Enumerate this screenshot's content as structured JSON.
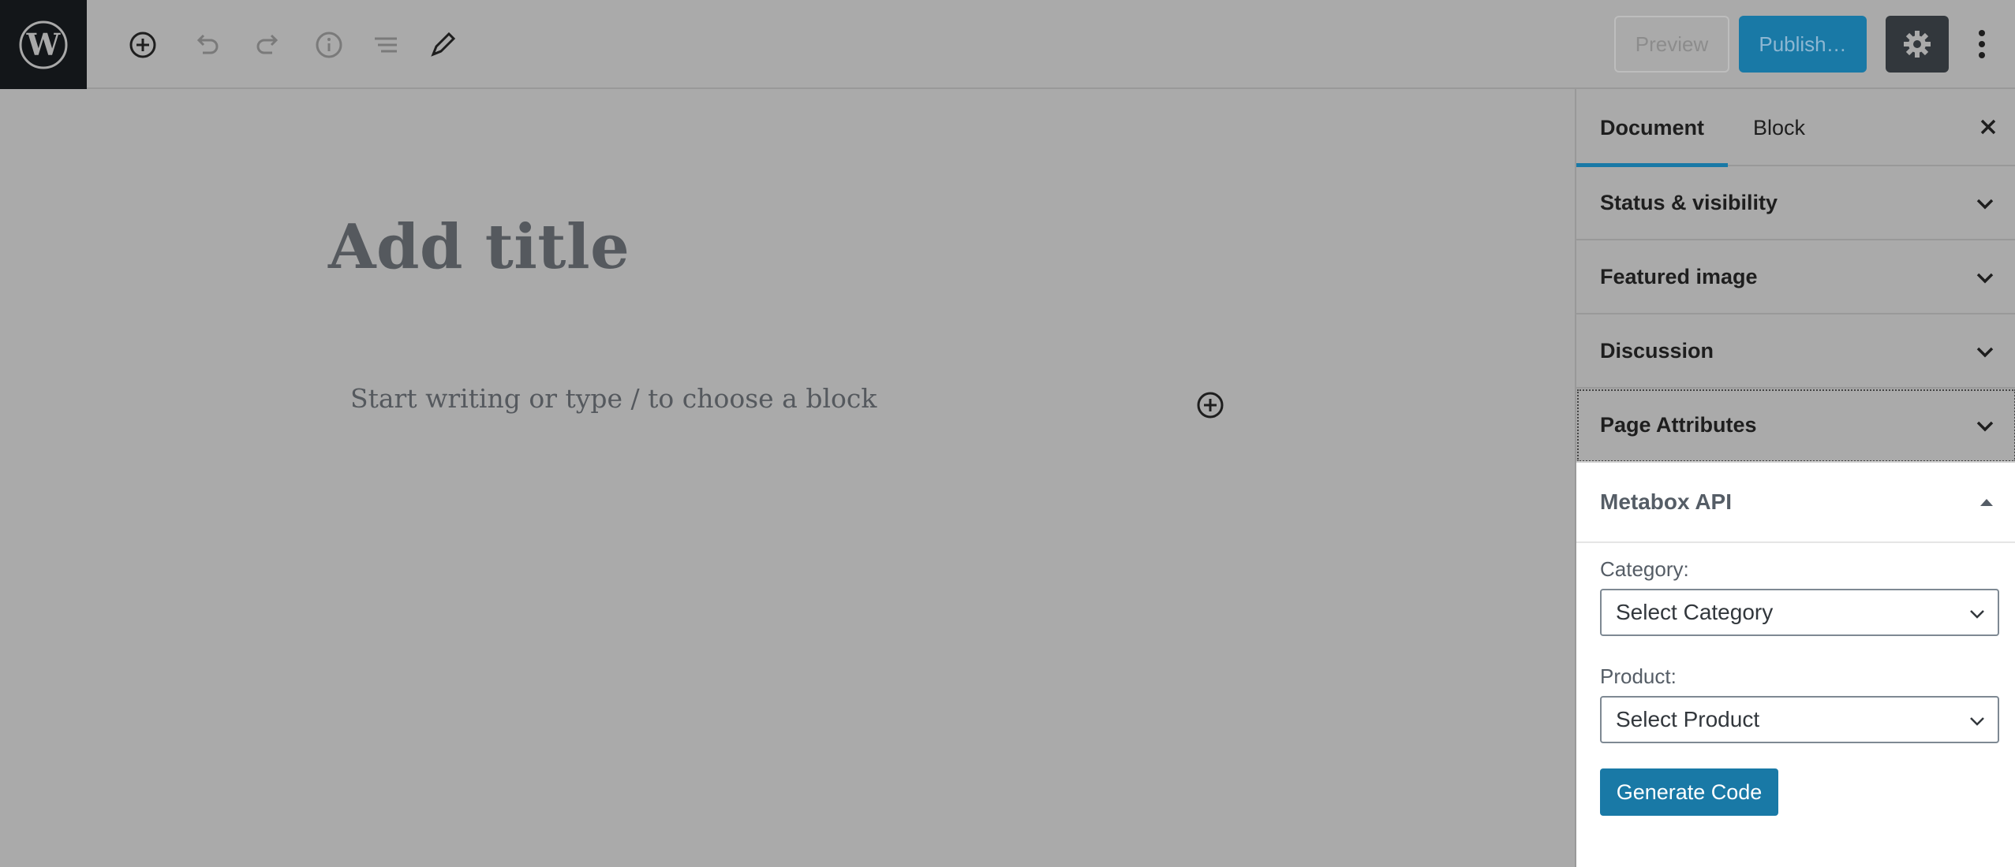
{
  "toolbar": {
    "preview_label": "Preview",
    "publish_label": "Publish…",
    "tools": [
      "add-block-icon",
      "undo-icon",
      "redo-icon",
      "info-icon",
      "list-view-icon",
      "edit-icon"
    ]
  },
  "editor": {
    "title_placeholder": "Add title",
    "body_placeholder": "Start writing or type / to choose a block"
  },
  "sidebar": {
    "tabs": [
      {
        "label": "Document"
      },
      {
        "label": "Block"
      }
    ],
    "panels": [
      {
        "label": "Status & visibility"
      },
      {
        "label": "Featured image"
      },
      {
        "label": "Discussion"
      },
      {
        "label": "Page Attributes"
      }
    ],
    "metabox": {
      "title": "Metabox API",
      "category_label": "Category:",
      "category_value": "Select Category",
      "product_label": "Product:",
      "product_value": "Select Product",
      "generate_label": "Generate Code"
    }
  },
  "colors": {
    "accent": "#1979a6",
    "overlay": "#aaaaaa",
    "dark": "#131619"
  }
}
